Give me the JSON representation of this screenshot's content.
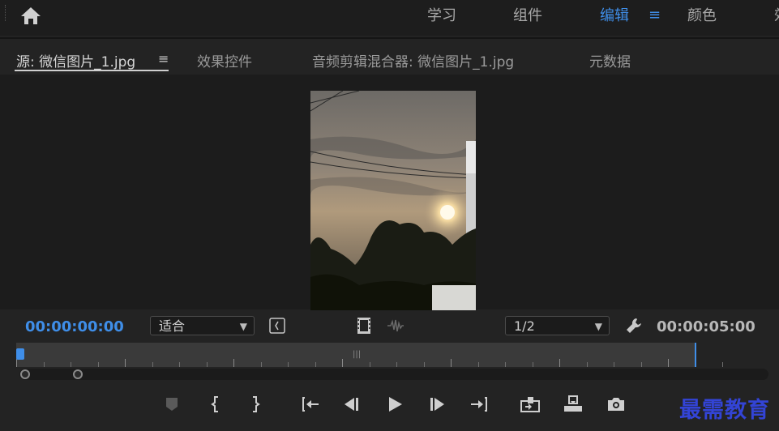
{
  "workspaces": [
    "学习",
    "组件",
    "编辑",
    "颜色",
    "效"
  ],
  "active_workspace": "编辑",
  "tabs": {
    "source": "源: 微信图片_1.jpg",
    "effect_controls": "效果控件",
    "audio_mixer": "音频剪辑混合器: 微信图片_1.jpg",
    "metadata": "元数据"
  },
  "timecode": {
    "current": "00:00:00:00",
    "duration": "00:00:05:00"
  },
  "zoom_select": "适合",
  "resolution_select": "1/2",
  "watermark": "最需教育",
  "colors": {
    "accent": "#3f8ee8",
    "background": "#232323"
  },
  "icons": [
    "home-icon",
    "panel-menu-icon",
    "marker-icon",
    "mark-in-icon",
    "mark-out-icon",
    "go-to-in-icon",
    "step-back-icon",
    "play-icon",
    "step-forward-icon",
    "go-to-out-icon",
    "insert-icon",
    "overwrite-icon",
    "export-frame-icon",
    "settings-wrench-icon",
    "drag-video-icon",
    "drag-audio-icon",
    "safe-margins-icon"
  ]
}
